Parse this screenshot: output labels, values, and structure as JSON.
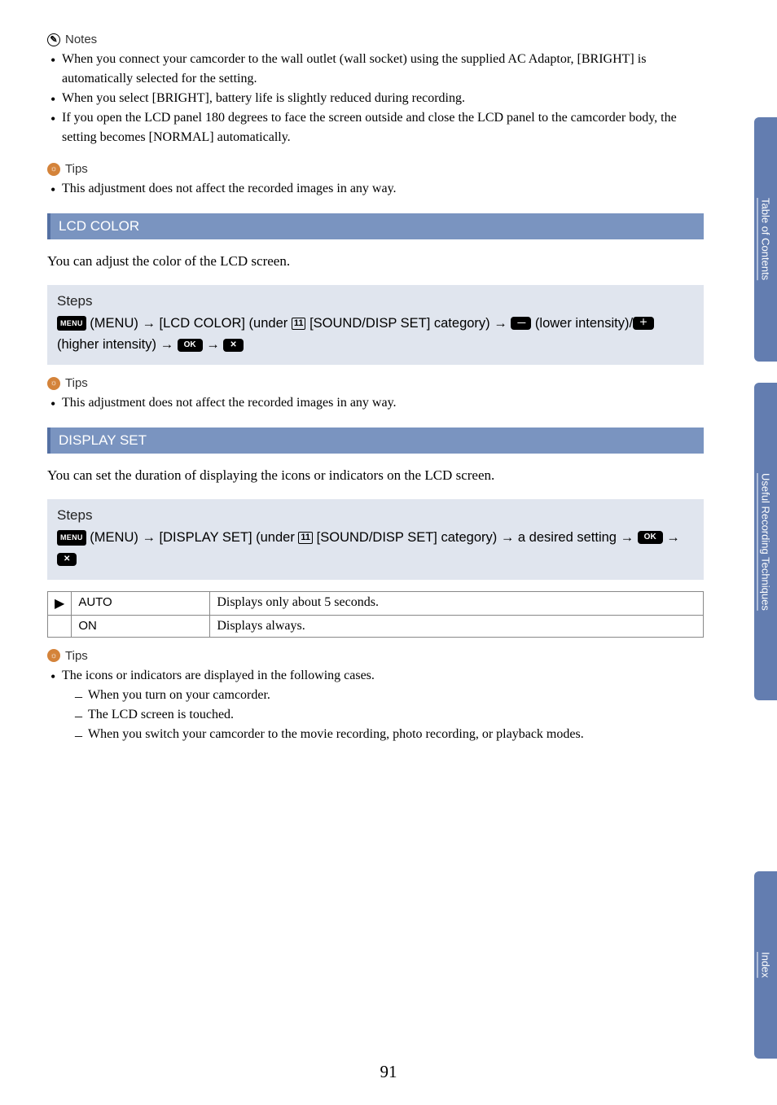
{
  "notes": {
    "label": "Notes",
    "items": [
      "When you connect your camcorder to the wall outlet (wall socket) using the supplied AC Adaptor, [BRIGHT] is automatically selected for the setting.",
      "When you select [BRIGHT], battery life is slightly reduced during recording.",
      "If you open the LCD panel 180 degrees to face the screen outside and close the LCD panel to the camcorder body, the setting becomes [NORMAL] automatically."
    ]
  },
  "tips1": {
    "label": "Tips",
    "items": [
      "This adjustment does not affect the recorded images in any way."
    ]
  },
  "lcd_color": {
    "header": "LCD COLOR",
    "desc": "You can adjust the color of the LCD screen.",
    "steps_title": "Steps",
    "steps": {
      "s1": " (MENU) ",
      "s2": " [LCD COLOR] (under ",
      "cat": " [SOUND/DISP SET] category) ",
      "s3": "  (lower intensity)/",
      "s4": " (higher intensity) "
    }
  },
  "tips2": {
    "label": "Tips",
    "items": [
      "This adjustment does not affect the recorded images in any way."
    ]
  },
  "display_set": {
    "header": "DISPLAY SET",
    "desc": "You can set the duration of displaying the icons or indicators on the LCD screen.",
    "steps_title": "Steps",
    "steps": {
      "s1": " (MENU) ",
      "s2": " [DISPLAY SET] (under ",
      "cat": " [SOUND/DISP SET] category) ",
      "s3": " a desired setting "
    },
    "options": [
      {
        "mark": "▶",
        "name": "AUTO",
        "desc": "Displays only about 5 seconds."
      },
      {
        "mark": "",
        "name": "ON",
        "desc": "Displays always."
      }
    ]
  },
  "tips3": {
    "label": "Tips",
    "lead": "The icons or indicators are displayed in the following cases.",
    "sub": [
      "When you turn on your camcorder.",
      "The LCD screen is touched.",
      "When you switch your camcorder to the movie recording, photo recording, or playback modes."
    ]
  },
  "icons": {
    "menu": "MENU",
    "num": "11",
    "ok": "OK",
    "arrow": "→"
  },
  "tabs": {
    "toc": "Table of Contents",
    "urt": "Useful Recording Techniques",
    "index": "Index"
  },
  "page": "91"
}
